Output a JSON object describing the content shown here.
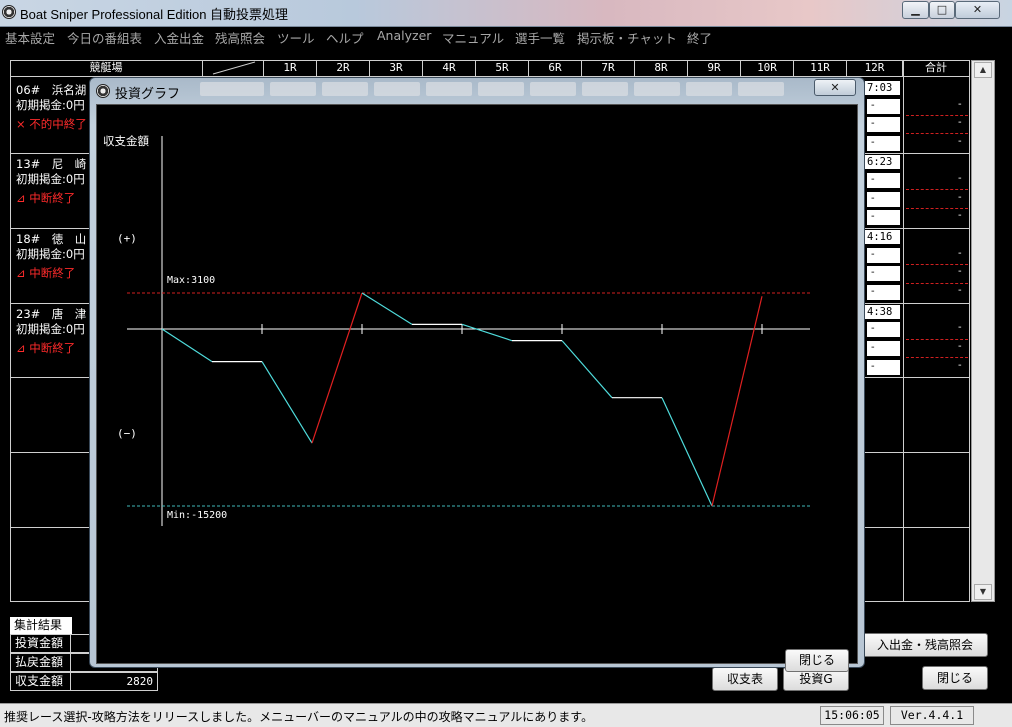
{
  "window": {
    "title": "Boat Sniper Professional Edition 自動投票処理",
    "minimize_glyph": "▁",
    "maximize_glyph": "□",
    "close_glyph": "✕"
  },
  "menu": [
    "基本設定",
    "今日の番組表",
    "入金出金",
    "残高照会",
    "ツール",
    "ヘルプ",
    "Analyzer",
    "マニュアル",
    "選手一覧",
    "掲示板・チャット",
    "終了"
  ],
  "table": {
    "venue_header": "競艇場",
    "race_headers": [
      "1R",
      "2R",
      "3R",
      "4R",
      "5R",
      "6R",
      "7R",
      "8R",
      "9R",
      "10R",
      "11R",
      "12R"
    ],
    "total_header": "合計",
    "venues": [
      {
        "name": "06#　浜名湖",
        "fund": "初期掲金:0円",
        "status": "× 不的中終了",
        "time": "7:03"
      },
      {
        "name": "13#　尼　崎",
        "fund": "初期掲金:0円",
        "status": "⊿ 中断終了",
        "time": "6:23"
      },
      {
        "name": "18#　徳　山",
        "fund": "初期掲金:0円",
        "status": "⊿ 中断終了",
        "time": "4:16"
      },
      {
        "name": "23#　唐　津",
        "fund": "初期掲金:0円",
        "status": "⊿ 中断終了",
        "time": "4:38"
      }
    ],
    "cell_dash": "-"
  },
  "summary": {
    "tab_label": "集計結果",
    "rows": [
      {
        "label": "投資金額",
        "value": ""
      },
      {
        "label": "払戻金額",
        "value": ""
      },
      {
        "label": "収支金額",
        "value": "2820"
      }
    ]
  },
  "buttons": {
    "deposit_balance": "入出金・残高照会",
    "balance": "収支表",
    "invest_graph": "投資G",
    "close": "閉じる"
  },
  "status_bar": {
    "message": "推奨レース選択-攻略方法をリリースしました。メニューバーのマニュアルの中の攻略マニュアルにあります。",
    "time": "15:06:05",
    "version": "Ver.4.4.1"
  },
  "dialog": {
    "title": "投資グラフ",
    "close_glyph": "✕",
    "close_button": "閉じる",
    "y_axis_label": "収支金額",
    "plus_label": "(+)",
    "minus_label": "(−)",
    "max_label": "Max:3100",
    "min_label": "Min:-15200"
  },
  "chart_data": {
    "type": "line",
    "ylabel": "収支金額",
    "max": 3100,
    "min": -15200,
    "ylim": [
      -15200,
      3100
    ],
    "x": [
      0,
      1,
      2,
      3,
      4,
      5,
      6,
      7,
      8,
      9,
      10,
      11,
      12
    ],
    "values": [
      0,
      -2800,
      -2800,
      -9800,
      3100,
      400,
      400,
      -1000,
      -1000,
      -5900,
      -5900,
      -15200,
      2820
    ],
    "colors": {
      "down": "#4fdcdc",
      "up": "#e02020",
      "flat": "#ffffff",
      "max_line": "#d02020",
      "min_line": "#3fb8b8",
      "axis": "#ffffff"
    }
  }
}
